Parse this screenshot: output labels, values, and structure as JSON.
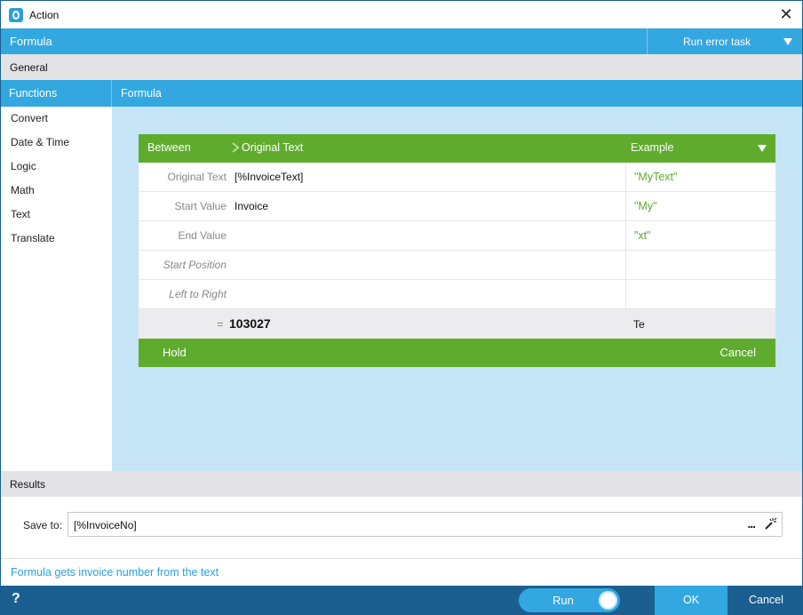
{
  "window": {
    "title": "Action"
  },
  "formula_bar": {
    "label": "Formula",
    "run_error_task": "Run error task"
  },
  "general": {
    "label": "General"
  },
  "functions": {
    "header": "Functions",
    "items": [
      "Convert",
      "Date & Time",
      "Logic",
      "Math",
      "Text",
      "Translate"
    ]
  },
  "formula_panel": {
    "header": "Formula"
  },
  "editor": {
    "function_name": "Between",
    "argument_header": "Original Text",
    "example_header": "Example",
    "params": [
      {
        "label": "Original Text",
        "value": "[%InvoiceText]",
        "example": "\"MyText\"",
        "optional": false
      },
      {
        "label": "Start Value",
        "value": "Invoice",
        "example": "\"My\"",
        "optional": false
      },
      {
        "label": "End Value",
        "value": "",
        "example": "\"xt\"",
        "optional": false
      },
      {
        "label": "Start Position",
        "value": "",
        "example": "",
        "optional": true
      },
      {
        "label": "Left to Right",
        "value": "",
        "example": "",
        "optional": true
      }
    ],
    "result": {
      "equals": "=",
      "value": "103027",
      "example": "Te"
    },
    "hold_label": "Hold",
    "cancel_label": "Cancel"
  },
  "results": {
    "header": "Results",
    "save_to_label": "Save to:",
    "save_to_value": "[%InvoiceNo]",
    "browse_label": "..."
  },
  "description": "Formula gets invoice number from the text",
  "bottom": {
    "help": "?",
    "run_label": "Run",
    "ok_label": "OK",
    "cancel_label": "Cancel"
  },
  "colors": {
    "accent_blue": "#33a7e0",
    "dark_blue": "#1a5f8f",
    "green": "#5fab2e",
    "light_blue_bg": "#c5e5f6"
  }
}
